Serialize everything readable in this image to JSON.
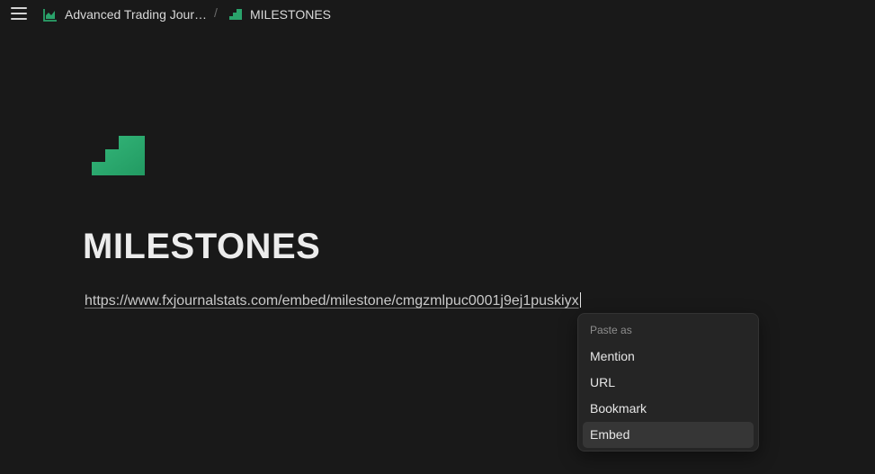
{
  "breadcrumb": {
    "workspace_title": "Advanced Trading Jour…",
    "workspace_icon": "chart-icon",
    "separator": "/",
    "page_title": "MILESTONES",
    "page_icon": "stairs-icon"
  },
  "page": {
    "icon": "stairs-icon",
    "title": "MILESTONES",
    "pasted_url": "https://www.fxjournalstats.com/embed/milestone/cmgzmlpuc0001j9ej1puskiyx"
  },
  "paste_menu": {
    "header": "Paste as",
    "items": [
      {
        "label": "Mention"
      },
      {
        "label": "URL"
      },
      {
        "label": "Bookmark"
      },
      {
        "label": "Embed"
      }
    ],
    "active_item": "Embed"
  },
  "colors": {
    "accent_green": "#2aa36b",
    "background": "#191919",
    "menu_background": "#252525"
  }
}
